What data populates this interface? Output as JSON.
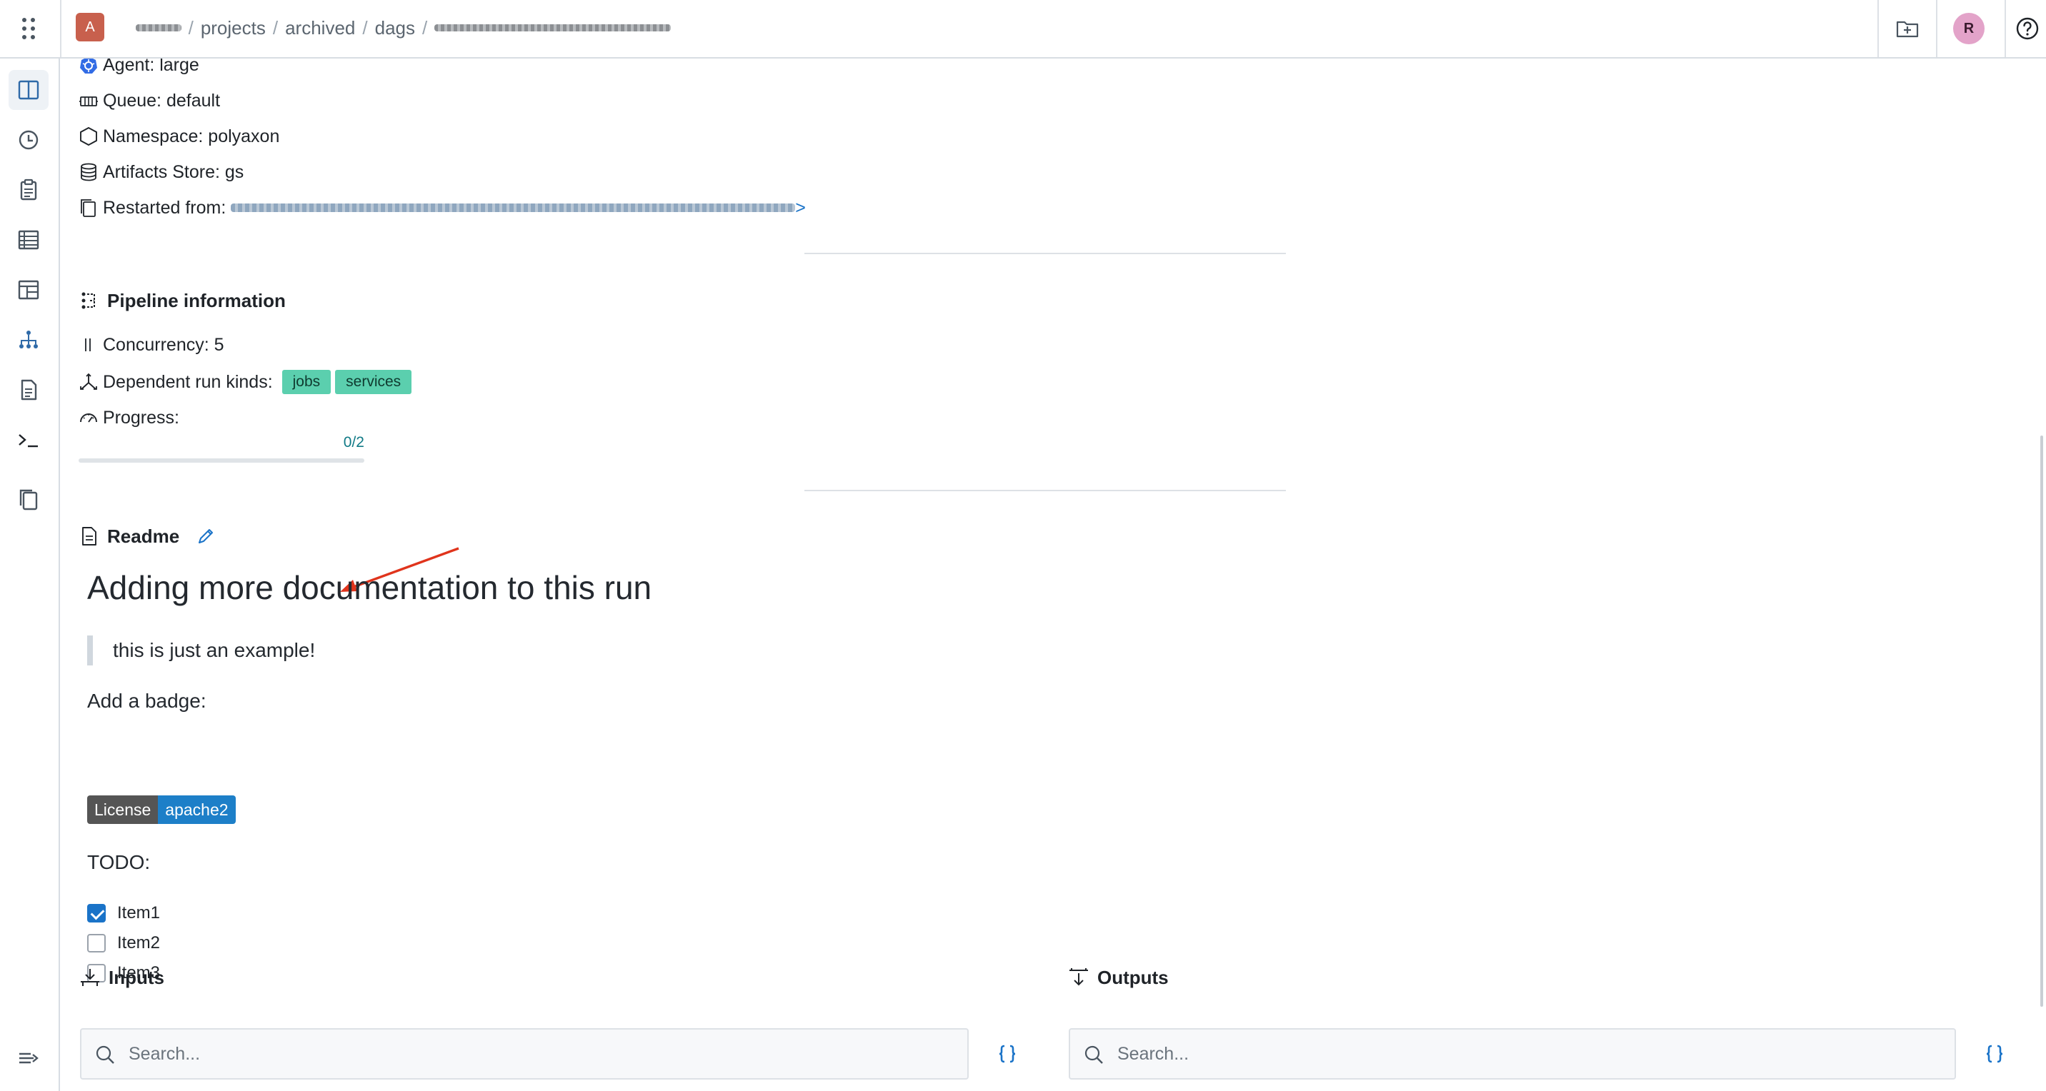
{
  "topbar": {
    "org_avatar": "A",
    "breadcrumb": {
      "org_redacted": "acme",
      "projects": "projects",
      "archived": "archived",
      "dags": "dags",
      "run_redacted": "experiment-with-tensorboard",
      "separator": "/"
    },
    "user_avatar": "R"
  },
  "run_meta": {
    "agent": "Agent: large",
    "queue": "Queue: default",
    "namespace": "Namespace: polyaxon",
    "artifacts_store": "Artifacts Store: gs",
    "restarted_from_label": "Restarted from:",
    "restarted_from_link_suffix": ">"
  },
  "pipeline": {
    "title": "Pipeline information",
    "concurrency": "Concurrency: 5",
    "dependent_label": "Dependent run kinds:",
    "kinds": [
      "jobs",
      "services"
    ],
    "progress_label": "Progress:",
    "progress_text": "0/2",
    "progress_fraction": 0
  },
  "readme": {
    "title": "Readme",
    "heading": "Adding more documentation to this run",
    "quote": "this is just an example!",
    "badge_intro": "Add a badge:",
    "badge_left": "License",
    "badge_right": "apache2",
    "todo_title": "TODO:",
    "todos": [
      {
        "label": "Item1",
        "checked": true
      },
      {
        "label": "Item2",
        "checked": false
      },
      {
        "label": "Item3",
        "checked": false
      }
    ]
  },
  "inputs": {
    "title": "Inputs",
    "search_placeholder": "Search..."
  },
  "outputs": {
    "title": "Outputs",
    "search_placeholder": "Search..."
  },
  "colors": {
    "accent": "#1a73c8",
    "tag_bg": "#5bcfae",
    "progress": "#117a86",
    "annotation": "#e0341c",
    "org_avatar_bg": "#c8604d",
    "user_avatar_bg": "#e3a3c9"
  },
  "icons": {
    "apps": "apps-grid-icon",
    "new_folder": "folder-add-icon",
    "help": "help-circle-icon",
    "agent": "kubernetes-icon",
    "queue": "queue-icon",
    "namespace": "hexagon-icon",
    "artifacts": "database-icon",
    "restarted": "copy-icon",
    "pipeline": "pipeline-icon",
    "concurrency": "parallel-icon",
    "dependent": "fork-icon",
    "progress": "dashboard-icon",
    "readme": "file-text-icon",
    "edit": "pencil-icon",
    "inputs": "import-icon",
    "outputs": "export-icon",
    "search": "search-icon",
    "json": "braces-icon"
  }
}
